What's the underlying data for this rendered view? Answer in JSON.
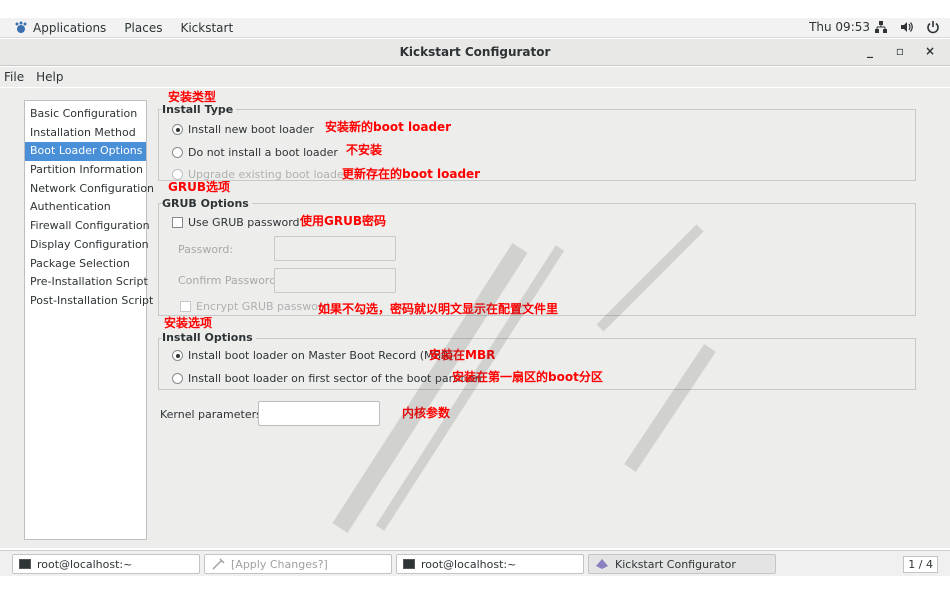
{
  "top_panel": {
    "applications": "Applications",
    "places": "Places",
    "app_name": "Kickstart",
    "clock": "Thu 09:53"
  },
  "window": {
    "title": "Kickstart Configurator"
  },
  "menubar": {
    "file": "File",
    "help": "Help"
  },
  "sidebar": {
    "items": [
      "Basic Configuration",
      "Installation Method",
      "Boot Loader Options",
      "Partition Information",
      "Network Configuration",
      "Authentication",
      "Firewall Configuration",
      "Display Configuration",
      "Package Selection",
      "Pre-Installation Script",
      "Post-Installation Script"
    ],
    "selected_index": 2
  },
  "install_type": {
    "label": "Install Type",
    "options": [
      "Install new boot loader",
      "Do not install a boot loader",
      "Upgrade existing boot loader"
    ]
  },
  "grub_options": {
    "label": "GRUB Options",
    "use_password": "Use GRUB password",
    "password_label": "Password:",
    "confirm_label": "Confirm Password:",
    "encrypt": "Encrypt GRUB password"
  },
  "install_options": {
    "label": "Install Options",
    "mbr": "Install boot loader on Master Boot Record (MBR)",
    "first_sector": "Install boot loader on first sector of the boot partition"
  },
  "kernel": {
    "label": "Kernel parameters:",
    "value": ""
  },
  "annotations": {
    "install_type": "安装类型",
    "new_loader": "安装新的boot loader",
    "no_install": "不安装",
    "upgrade": "更新存在的boot loader",
    "grub_options": "GRUB选项",
    "grub_password": "使用GRUB密码",
    "encrypt_note": "如果不勾选，密码就以明文显示在配置文件里",
    "install_options": "安装选项",
    "mbr": "安装在MBR",
    "first_sector": "安装在第一扇区的boot分区",
    "kernel": "内核参数"
  },
  "taskbar": {
    "tasks": [
      "root@localhost:~",
      "[Apply Changes?]",
      "root@localhost:~",
      "Kickstart Configurator"
    ],
    "pager": "1 / 4"
  },
  "colors": {
    "accent": "#4a90d9",
    "annotation": "#ff0000",
    "background": "#ededec"
  }
}
